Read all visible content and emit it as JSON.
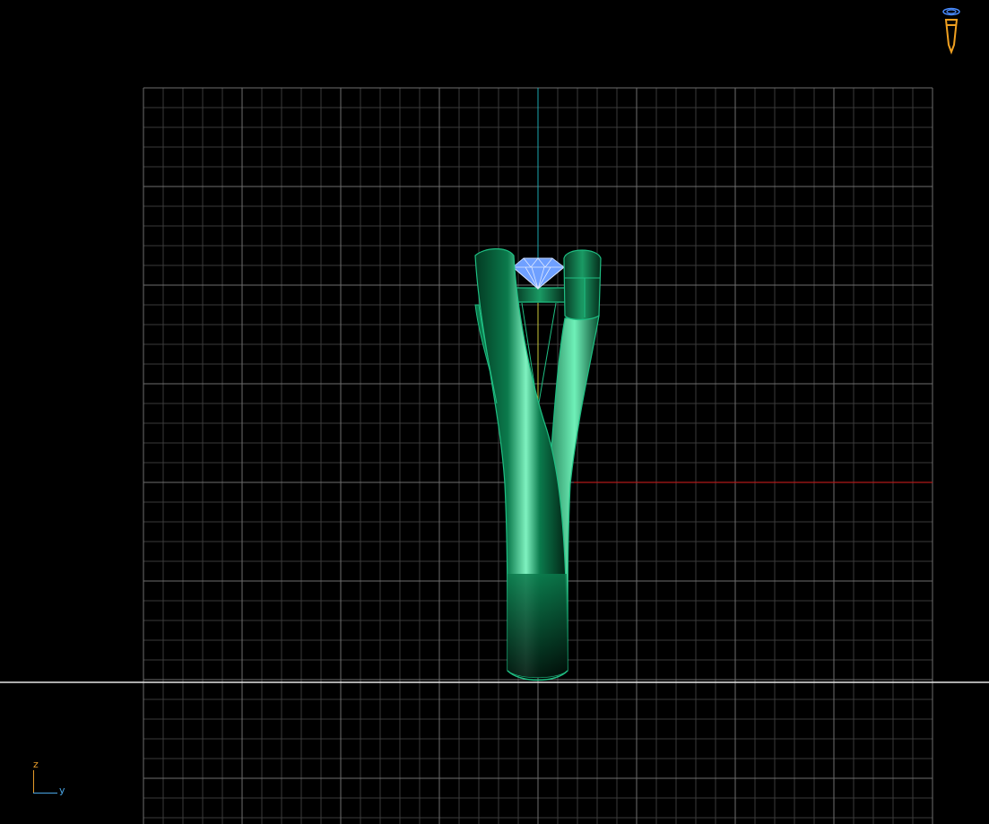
{
  "viewport": {
    "view": "front",
    "background_color": "#000000",
    "grid": {
      "visible": true,
      "minor_color": "#3a3a3a",
      "major_color": "#6e6e6e",
      "minor_divisions_per_major": 5
    },
    "axes": {
      "vertical_axis_color": "#1aa6b0",
      "horizontal_axis_color": "#b01818",
      "ground_line_color": "#e6e6e6"
    }
  },
  "model": {
    "object": "ring",
    "band_color": "#0b7a4c",
    "band_highlight_color": "#7ff2c0",
    "band_edge_color": "#1fbf83",
    "gem_color": "#6fa0ff",
    "gem_edge_color": "#bcd3ff"
  },
  "axis_indicator": {
    "z_label": "z",
    "y_label": "y",
    "z_color": "#e59a2a",
    "y_color": "#4aa6e6"
  },
  "view_cube": {
    "icon": "view-orientation-icon",
    "color": "#f0a020",
    "accent_color": "#4a8cff"
  }
}
